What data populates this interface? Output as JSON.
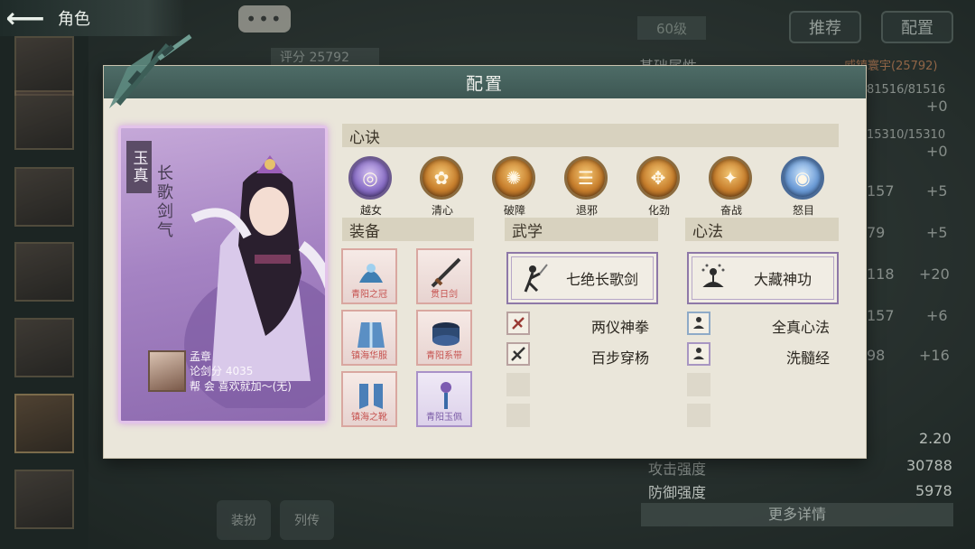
{
  "topbar": {
    "back_icon": "arrow-left-icon",
    "title": "角色"
  },
  "chat_button": {
    "icon": "ellipsis-icon",
    "label": "•••"
  },
  "background": {
    "level": "60级",
    "recommend_label": "推荐",
    "config_label": "配置",
    "score": "评分  25792",
    "basic_attr_label": "基础属性",
    "player_tag": "威镇寰宇(25792)",
    "stats": [
      "81516/81516",
      "+0",
      "15310/15310",
      "+0",
      "157",
      "+5",
      "79",
      "+5",
      "118",
      "+20",
      "157",
      "+6",
      "98",
      "+16",
      "2.20",
      "攻击强度",
      "30788",
      "防御强度",
      "5978"
    ],
    "more_details": "更多详情",
    "bottom_buttons": [
      "装扮",
      "列传"
    ]
  },
  "modal": {
    "title": "配置",
    "character": {
      "tag": "玉真",
      "name": "长歌剑气",
      "player_name": "孟章",
      "sword_score": "论剑分 4035",
      "guild": "帮  会 喜欢就加～(无)"
    },
    "xinjue": {
      "title": "心诀",
      "items": [
        {
          "label": "越女",
          "color": "purple"
        },
        {
          "label": "清心",
          "color": "gold"
        },
        {
          "label": "破障",
          "color": "gold"
        },
        {
          "label": "退邪",
          "color": "gold"
        },
        {
          "label": "化劲",
          "color": "gold"
        },
        {
          "label": "奋战",
          "color": "gold"
        },
        {
          "label": "怒目",
          "color": "blue"
        }
      ]
    },
    "equipment": {
      "title": "装备",
      "items": [
        {
          "label": "青阳之冠",
          "rarity": "red"
        },
        {
          "label": "贯日剑",
          "rarity": "red"
        },
        {
          "label": "镇海华服",
          "rarity": "red"
        },
        {
          "label": "青阳系带",
          "rarity": "red"
        },
        {
          "label": "镇海之靴",
          "rarity": "red"
        },
        {
          "label": "青阳玉佩",
          "rarity": "purple"
        }
      ]
    },
    "martial": {
      "title": "武学",
      "main": "七绝长歌剑",
      "subs": [
        "两仪神拳",
        "百步穿杨"
      ]
    },
    "mind": {
      "title": "心法",
      "main": "大藏神功",
      "subs": [
        "全真心法",
        "洗髓经"
      ]
    }
  },
  "colors": {
    "modal_bg": "#eae6da",
    "header": "#4e6c67",
    "section_bar": "#d8d2bf",
    "card_purple": "#a583c3",
    "equip_red": "#c6524f"
  }
}
